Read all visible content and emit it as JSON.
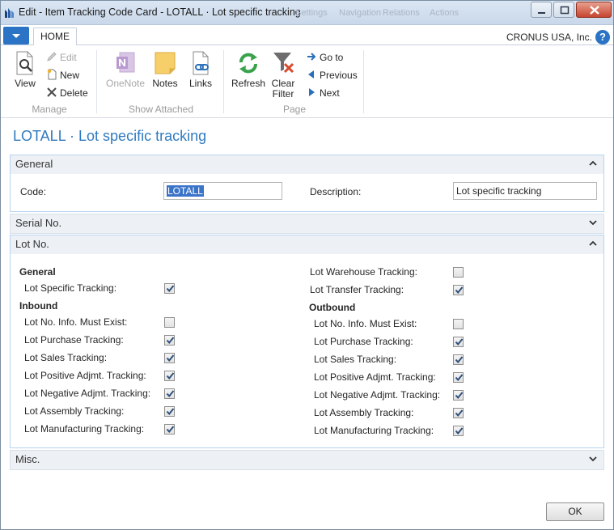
{
  "window": {
    "title": "Edit - Item Tracking Code Card - LOTALL · Lot specific tracking",
    "faded_tabs": [
      "Settings",
      "Navigation",
      "Relations",
      "Actions"
    ]
  },
  "ribbon": {
    "tab_home": "HOME",
    "company": "CRONUS USA, Inc.",
    "help": "?",
    "view": "View",
    "edit": "Edit",
    "new": "New",
    "delete": "Delete",
    "group_manage": "Manage",
    "onenote": "OneNote",
    "notes": "Notes",
    "links": "Links",
    "group_show_attached": "Show Attached",
    "refresh": "Refresh",
    "clear_filter_line1": "Clear",
    "clear_filter_line2": "Filter",
    "go_to": "Go to",
    "previous": "Previous",
    "next": "Next",
    "group_page": "Page"
  },
  "page": {
    "title": "LOTALL · Lot specific tracking"
  },
  "general": {
    "header": "General",
    "code_label": "Code:",
    "code_value": "LOTALL",
    "description_label": "Description:",
    "description_value": "Lot specific tracking"
  },
  "serial": {
    "header": "Serial No."
  },
  "lot": {
    "header": "Lot No.",
    "left": {
      "general_head": "General",
      "lot_specific": {
        "label": "Lot Specific Tracking:",
        "checked": true
      },
      "inbound_head": "Inbound",
      "rows": [
        {
          "label": "Lot No. Info. Must Exist:",
          "checked": false
        },
        {
          "label": "Lot Purchase Tracking:",
          "checked": true
        },
        {
          "label": "Lot Sales Tracking:",
          "checked": true
        },
        {
          "label": "Lot Positive Adjmt. Tracking:",
          "checked": true
        },
        {
          "label": "Lot Negative Adjmt. Tracking:",
          "checked": true
        },
        {
          "label": "Lot Assembly Tracking:",
          "checked": true
        },
        {
          "label": "Lot Manufacturing Tracking:",
          "checked": true
        }
      ]
    },
    "right": {
      "warehouse": {
        "label": "Lot Warehouse Tracking:",
        "checked": false
      },
      "transfer": {
        "label": "Lot Transfer Tracking:",
        "checked": true
      },
      "outbound_head": "Outbound",
      "rows": [
        {
          "label": "Lot No. Info. Must Exist:",
          "checked": false
        },
        {
          "label": "Lot Purchase Tracking:",
          "checked": true
        },
        {
          "label": "Lot Sales Tracking:",
          "checked": true
        },
        {
          "label": "Lot Positive Adjmt. Tracking:",
          "checked": true
        },
        {
          "label": "Lot Negative Adjmt. Tracking:",
          "checked": true
        },
        {
          "label": "Lot Assembly Tracking:",
          "checked": true
        },
        {
          "label": "Lot Manufacturing Tracking:",
          "checked": true
        }
      ]
    }
  },
  "misc": {
    "header": "Misc."
  },
  "footer": {
    "ok": "OK"
  }
}
